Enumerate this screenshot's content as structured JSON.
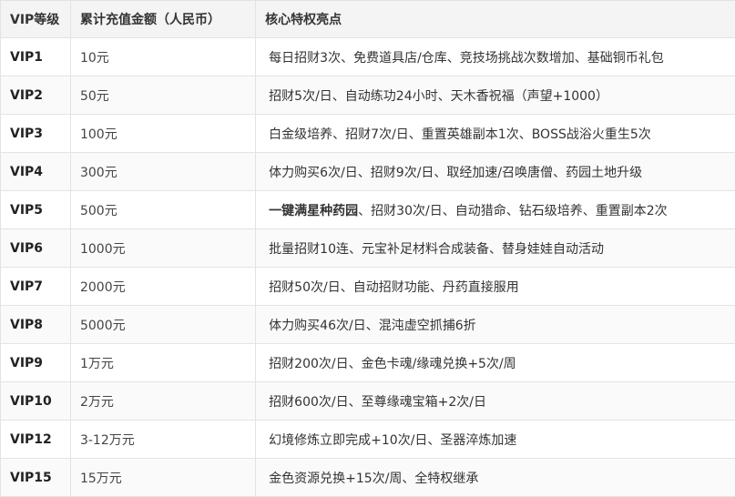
{
  "table": {
    "headers": [
      "VIP等级",
      "累计充值金额（人民币）",
      "核心特权亮点"
    ],
    "rows": [
      {
        "level": "VIP1",
        "amount": "10元",
        "perks_bold": "",
        "perks": "每日招财3次、免费道具店/仓库、竞技场挑战次数增加、基础铜币礼包"
      },
      {
        "level": "VIP2",
        "amount": "50元",
        "perks_bold": "",
        "perks": "招财5次/日、自动练功24小时、天木香祝福（声望+1000）"
      },
      {
        "level": "VIP3",
        "amount": "100元",
        "perks_bold": "",
        "perks": "白金级培养、招财7次/日、重置英雄副本1次、BOSS战浴火重生5次"
      },
      {
        "level": "VIP4",
        "amount": "300元",
        "perks_bold": "",
        "perks": "体力购买6次/日、招财9次/日、取经加速/召唤唐僧、药园土地升级"
      },
      {
        "level": "VIP5",
        "amount": "500元",
        "perks_bold": "一键满星种药园",
        "perks": "、招财30次/日、自动猎命、钻石级培养、重置副本2次"
      },
      {
        "level": "VIP6",
        "amount": "1000元",
        "perks_bold": "",
        "perks": "批量招财10连、元宝补足材料合成装备、替身娃娃自动活动"
      },
      {
        "level": "VIP7",
        "amount": "2000元",
        "perks_bold": "",
        "perks": "招财50次/日、自动招财功能、丹药直接服用"
      },
      {
        "level": "VIP8",
        "amount": "5000元",
        "perks_bold": "",
        "perks": "体力购买46次/日、混沌虚空抓捕6折"
      },
      {
        "level": "VIP9",
        "amount": "1万元",
        "perks_bold": "",
        "perks": "招财200次/日、金色卡魂/缘魂兑换+5次/周"
      },
      {
        "level": "VIP10",
        "amount": "2万元",
        "perks_bold": "",
        "perks": "招财600次/日、至尊缘魂宝箱+2次/日"
      },
      {
        "level": "VIP12",
        "amount": "3-12万元",
        "perks_bold": "",
        "perks": "幻境修炼立即完成+10次/日、圣器淬炼加速"
      },
      {
        "level": "VIP15",
        "amount": "15万元",
        "perks_bold": "",
        "perks": "金色资源兑换+15次/周、全特权继承"
      }
    ]
  }
}
